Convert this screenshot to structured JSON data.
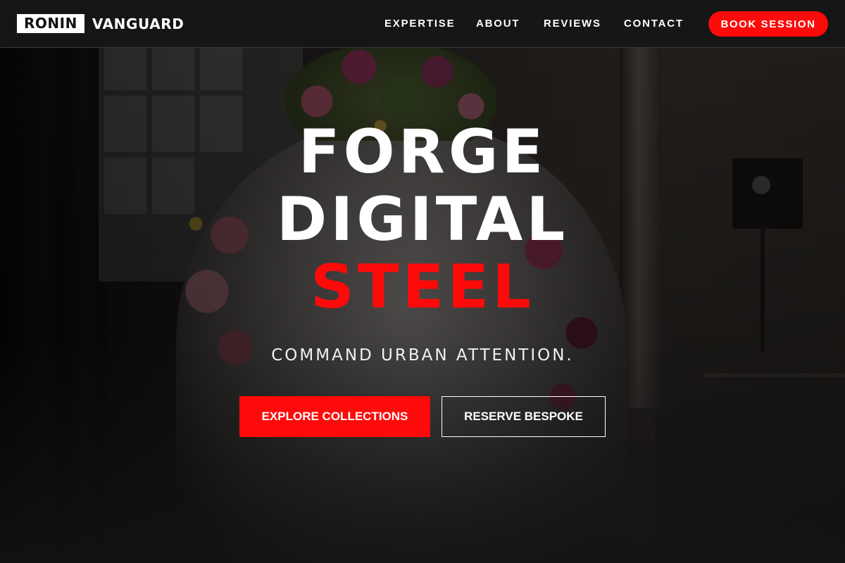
{
  "brand": {
    "logo_box_text": "RONIN",
    "logo_word_text": "VANGUARD"
  },
  "nav": {
    "items": [
      {
        "label": "EXPERTISE"
      },
      {
        "label": "ABOUT"
      },
      {
        "label": "REVIEWS"
      },
      {
        "label": "CONTACT"
      }
    ],
    "cta_label": "BOOK SESSION"
  },
  "hero": {
    "headline_line1": "FORGE",
    "headline_line2": "DIGITAL",
    "headline_line3": "STEEL",
    "tagline": "COMMAND URBAN ATTENTION.",
    "primary_cta": "EXPLORE COLLECTIONS",
    "secondary_cta": "RESERVE BESPOKE",
    "background_image_subject": "dress-with-flower-crown-photo"
  },
  "colors": {
    "accent": "#ff0a0a",
    "header_bg": "#161616",
    "text": "#ffffff"
  }
}
